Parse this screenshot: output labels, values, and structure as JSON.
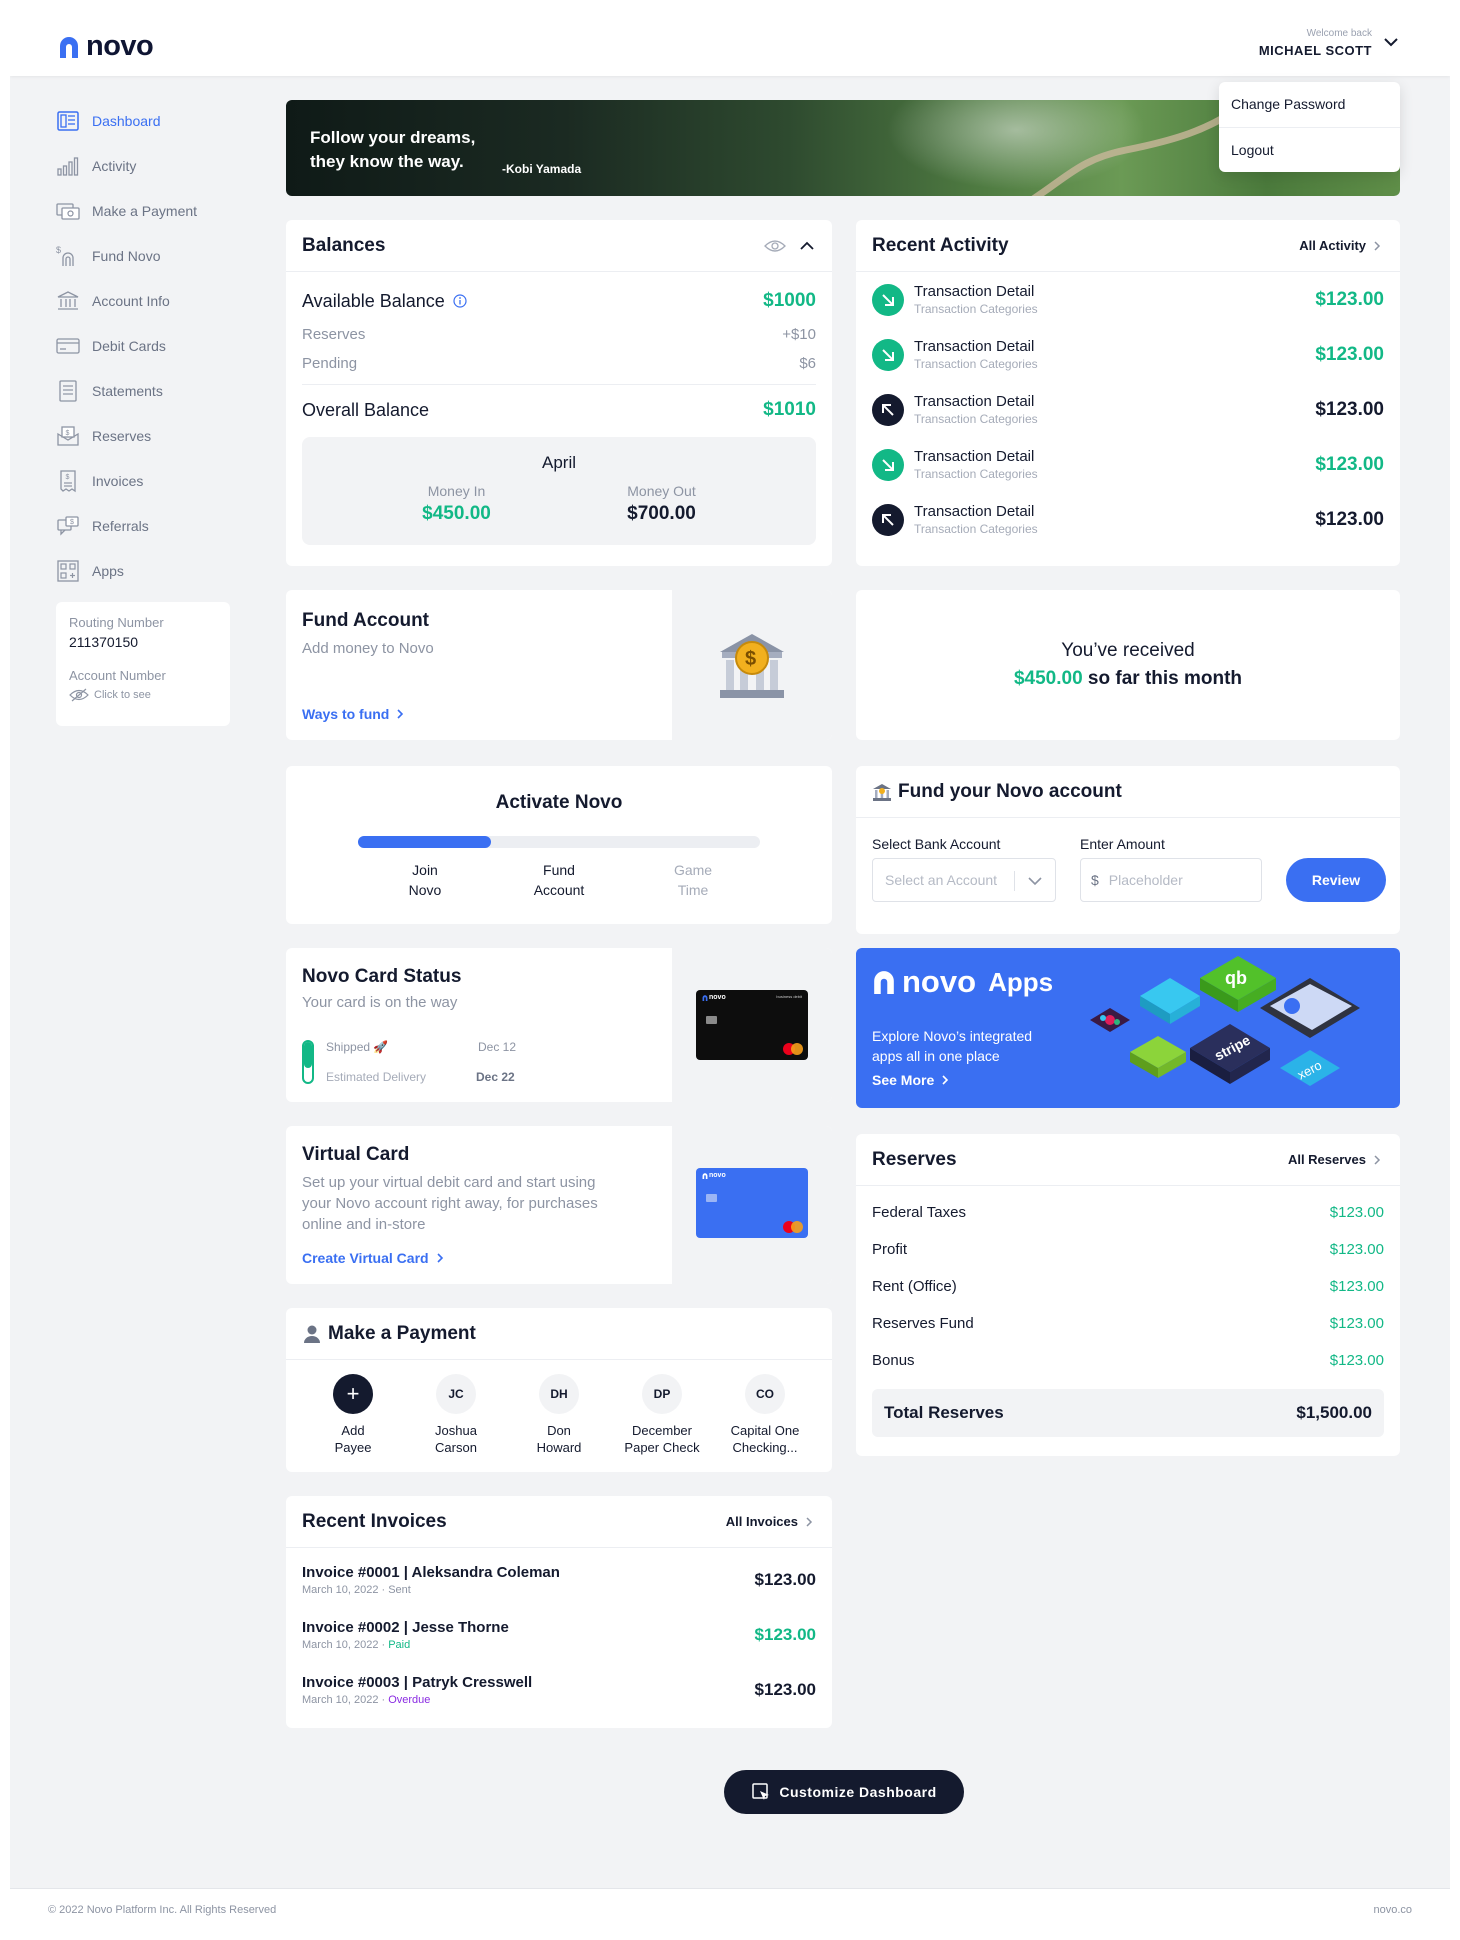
{
  "brand": {
    "name": "novo",
    "accent": "#3a6ff2",
    "green": "#12b886",
    "navy": "#141a2e"
  },
  "user": {
    "welcome": "Welcome back",
    "name": "MICHAEL SCOTT"
  },
  "user_menu": [
    "Change Password",
    "Logout"
  ],
  "sidebar": {
    "items": [
      {
        "label": "Dashboard",
        "icon": "dashboard-icon",
        "active": true
      },
      {
        "label": "Activity",
        "icon": "activity-icon"
      },
      {
        "label": "Make a Payment",
        "icon": "payment-icon"
      },
      {
        "label": "Fund Novo",
        "icon": "fund-icon"
      },
      {
        "label": "Account Info",
        "icon": "bank-icon"
      },
      {
        "label": "Debit Cards",
        "icon": "card-icon"
      },
      {
        "label": "Statements",
        "icon": "statement-icon"
      },
      {
        "label": "Reserves",
        "icon": "reserves-icon"
      },
      {
        "label": "Invoices",
        "icon": "invoice-icon"
      },
      {
        "label": "Referrals",
        "icon": "referral-icon"
      },
      {
        "label": "Apps",
        "icon": "apps-icon"
      }
    ]
  },
  "account": {
    "routing_label": "Routing Number",
    "routing_number": "211370150",
    "account_label": "Account Number",
    "click_to_see": "Click to see"
  },
  "hero": {
    "quote_line1": "Follow your dreams,",
    "quote_line2": "they know the way.",
    "author": "-Kobi Yamada"
  },
  "balances": {
    "title": "Balances",
    "available_label": "Available Balance",
    "available": "$1000",
    "reserves_label": "Reserves",
    "reserves": "+$10",
    "pending_label": "Pending",
    "pending": "$6",
    "overall_label": "Overall Balance",
    "overall": "$1010",
    "month": "April",
    "money_in_label": "Money In",
    "money_in": "$450.00",
    "money_out_label": "Money Out",
    "money_out": "$700.00"
  },
  "recent_activity": {
    "title": "Recent Activity",
    "link": "All Activity",
    "items": [
      {
        "title": "Transaction Detail",
        "sub": "Transaction Categories",
        "amount": "$123.00",
        "direction": "in"
      },
      {
        "title": "Transaction Detail",
        "sub": "Transaction Categories",
        "amount": "$123.00",
        "direction": "in"
      },
      {
        "title": "Transaction Detail",
        "sub": "Transaction Categories",
        "amount": "$123.00",
        "direction": "out"
      },
      {
        "title": "Transaction Detail",
        "sub": "Transaction Categories",
        "amount": "$123.00",
        "direction": "in"
      },
      {
        "title": "Transaction Detail",
        "sub": "Transaction Categories",
        "amount": "$123.00",
        "direction": "out"
      }
    ]
  },
  "fund_account": {
    "title": "Fund Account",
    "sub": "Add money to Novo",
    "link": "Ways to fund"
  },
  "received": {
    "line1": "You’ve received",
    "amount": "$450.00",
    "line2": " so far this month"
  },
  "activate": {
    "title": "Activate Novo",
    "progress": 0.33,
    "steps": [
      {
        "l1": "Join",
        "l2": "Novo",
        "done": true
      },
      {
        "l1": "Fund",
        "l2": "Account",
        "done": true
      },
      {
        "l1": "Game",
        "l2": "Time",
        "done": false
      }
    ]
  },
  "fund_form": {
    "title": "Fund your Novo account",
    "bank_label": "Select Bank Account",
    "bank_placeholder": "Select an Account",
    "amount_label": "Enter Amount",
    "currency": "$",
    "amount_placeholder": "Placeholder",
    "button": "Review"
  },
  "card_status": {
    "title": "Novo Card Status",
    "sub": "Your card is on the way",
    "shipped_label": "Shipped 🚀",
    "shipped_date": "Dec 12",
    "delivery_label": "Estimated Delivery",
    "delivery_date": "Dec 22",
    "card_brand": "novo",
    "card_tag": "business debit"
  },
  "apps_banner": {
    "brand": "novo",
    "title": "Apps",
    "desc_line1": "Explore Novo’s integrated",
    "desc_line2": "apps all in one place",
    "link": "See More",
    "tile_labels": [
      "stripe",
      "xero"
    ]
  },
  "virtual_card": {
    "title": "Virtual Card",
    "desc_line1": "Set up your virtual debit card and start using",
    "desc_line2": "your Novo account right away, for purchases",
    "desc_line3": "online and in-store",
    "link": "Create Virtual Card",
    "card_brand": "novo"
  },
  "reserves": {
    "title": "Reserves",
    "link": "All Reserves",
    "items": [
      {
        "label": "Federal Taxes",
        "amount": "$123.00"
      },
      {
        "label": "Profit",
        "amount": "$123.00"
      },
      {
        "label": "Rent (Office)",
        "amount": "$123.00"
      },
      {
        "label": "Reserves Fund",
        "amount": "$123.00"
      },
      {
        "label": "Bonus",
        "amount": "$123.00"
      }
    ],
    "total_label": "Total Reserves",
    "total": "$1,500.00"
  },
  "payment": {
    "title": "Make a Payment",
    "payees": [
      {
        "initials": "+",
        "l1": "Add",
        "l2": "Payee"
      },
      {
        "initials": "JC",
        "l1": "Joshua",
        "l2": "Carson"
      },
      {
        "initials": "DH",
        "l1": "Don",
        "l2": "Howard"
      },
      {
        "initials": "DP",
        "l1": "December",
        "l2": "Paper Check"
      },
      {
        "initials": "CO",
        "l1": "Capital One",
        "l2": "Checking..."
      }
    ]
  },
  "invoices": {
    "title": "Recent Invoices",
    "link": "All Invoices",
    "items": [
      {
        "title": "Invoice #0001 | Aleksandra Coleman",
        "date": "March 10, 2022 · ",
        "status": "Sent",
        "status_color": "#8d94a3",
        "amount": "$123.00",
        "amount_color": "#141a2e"
      },
      {
        "title": "Invoice #0002 | Jesse Thorne",
        "date": "March 10, 2022 · ",
        "status": "Paid",
        "status_color": "#12b886",
        "amount": "$123.00",
        "amount_color": "#12b886"
      },
      {
        "title": "Invoice #0003 | Patryk Cresswell",
        "date": "March 10, 2022 · ",
        "status": "Overdue",
        "status_color": "#8a2be2",
        "amount": "$123.00",
        "amount_color": "#141a2e"
      }
    ]
  },
  "customize": "Customize Dashboard",
  "footer": {
    "left": "© 2022 Novo Platform Inc. All Rights Reserved",
    "right": "novo.co"
  }
}
